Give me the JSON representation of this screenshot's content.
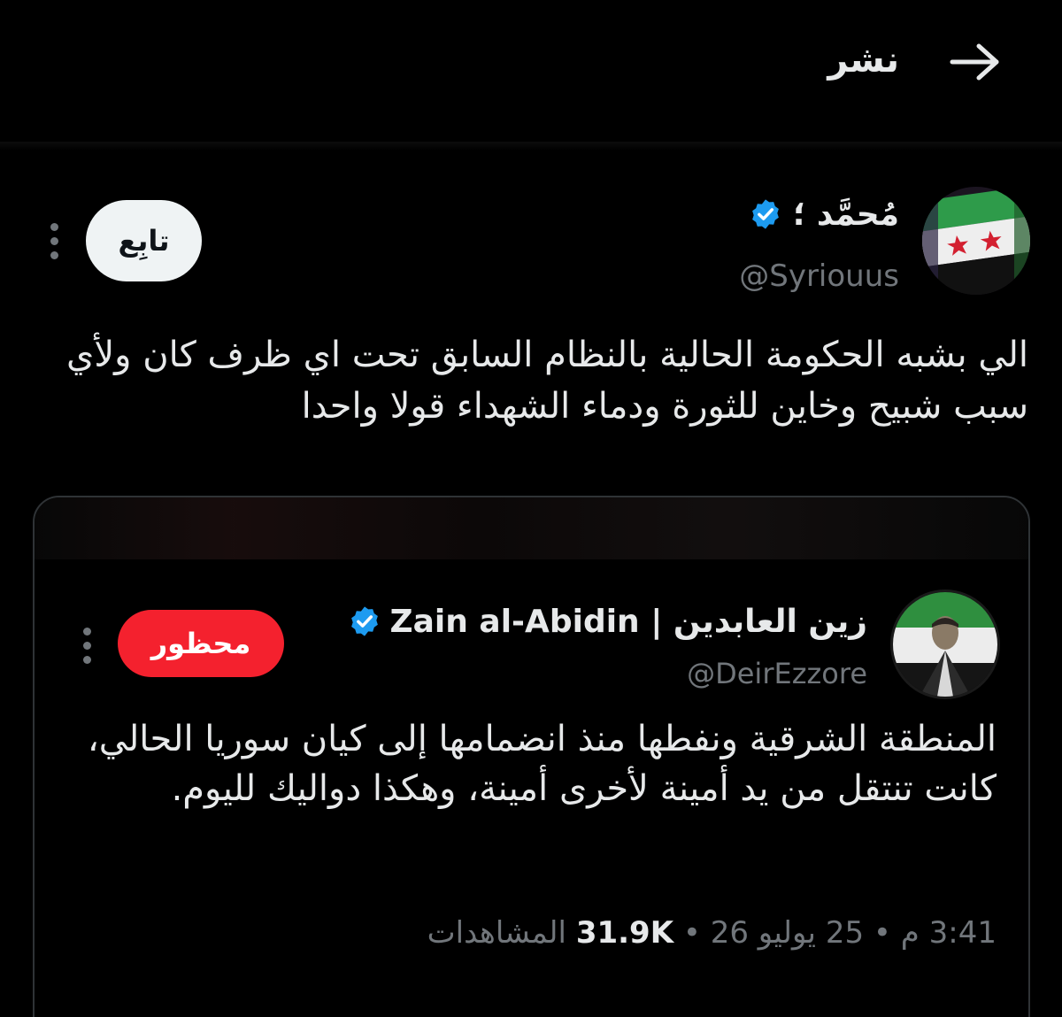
{
  "header": {
    "title": "نشر"
  },
  "author": {
    "name": "مُحمَّد ؛",
    "handle": "@Syriouus",
    "follow_label": "تابِع"
  },
  "tweet": {
    "text": "الي بشبه الحكومة الحالية بالنظام السابق تحت اي ظرف كان ولأي سبب شبيح وخاين للثورة ودماء الشهداء قولا واحدا"
  },
  "quote": {
    "name": "Zain al-Abidin | زين العابدين",
    "handle": "@DeirEzzore",
    "blocked_label": "محظور",
    "text": "المنطقة الشرقية ونفطها منذ انضمامها إلى كيان سوريا الحالي، كانت تنتقل من يد أمينة لأخرى أمينة، وهكذا دواليك لليوم.",
    "time": "3:41 م",
    "separator": "•",
    "date": "25 يوليو 26",
    "views_count": "31.9K",
    "views_label": "المشاهدات"
  },
  "colors": {
    "background": "#000000",
    "text_primary": "#e7e9ea",
    "text_secondary": "#71767b",
    "verified_blue": "#1d9bf0",
    "blocked_red": "#f4212e",
    "follow_bg": "#eff3f4"
  },
  "icons": {
    "back": "arrow-right-icon",
    "verified": "verified-badge-icon",
    "more": "more-vertical-icon"
  }
}
